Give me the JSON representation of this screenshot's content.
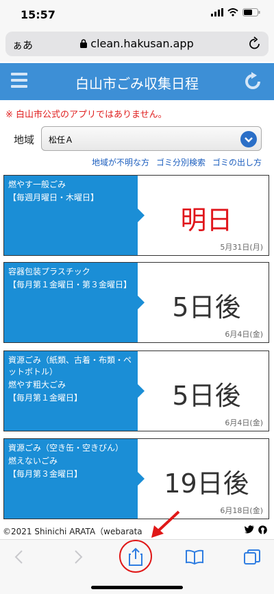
{
  "status": {
    "time": "15:57"
  },
  "browser": {
    "aa": "ぁあ",
    "url": "clean.hakusan.app"
  },
  "app": {
    "title": "白山市ごみ収集日程"
  },
  "notice": "※ 白山市公式のアプリではありません。",
  "region": {
    "label": "地域",
    "value": "松任Ａ"
  },
  "links": [
    "地域が不明な方",
    "ゴミ分別検索",
    "ゴミの出し方"
  ],
  "cards": [
    {
      "lines": [
        "燃やす一般ごみ",
        "【毎週月曜日・木曜日】"
      ],
      "big": "明日",
      "date": "5月31日(月)"
    },
    {
      "lines": [
        "容器包装プラスチック",
        "【毎月第１金曜日・第３金曜日】"
      ],
      "big": "5日後",
      "date": "6月4日(金)"
    },
    {
      "lines": [
        "資源ごみ（紙類、古着・布類・ペットボトル）",
        "燃やす粗大ごみ",
        "【毎月第１金曜日】"
      ],
      "big": "5日後",
      "date": "6月4日(金)"
    },
    {
      "lines": [
        "資源ごみ（空き缶・空きびん）",
        "燃えないごみ",
        "【毎月第３金曜日】"
      ],
      "big": "19日後",
      "date": "6月18日(金)"
    }
  ],
  "footer": {
    "copyright": "©2021 Shinichi ARATA（webarata"
  },
  "colors": {
    "header": "#3d8fd6",
    "card": "#1b8ed6",
    "accent_red": "#e0161c"
  }
}
